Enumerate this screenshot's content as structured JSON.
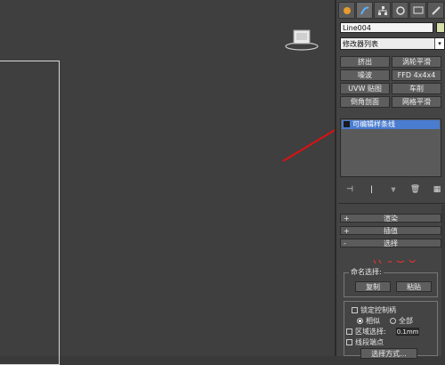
{
  "object_name": "Line004",
  "modifier_list": "修改器列表",
  "dropdown_arrow": "▾",
  "modifier_buttons": [
    "挤出",
    "涡轮平滑",
    "噪波",
    "FFD 4x4x4",
    "UVW 贴图",
    "车削",
    "倒角剖面",
    "网格平滑"
  ],
  "stack_item": "可编辑样条线",
  "rollouts": {
    "render": {
      "sign": "+",
      "label": "渲染"
    },
    "interp": {
      "sign": "+",
      "label": "插值"
    },
    "select": {
      "sign": "-",
      "label": "选择"
    }
  },
  "named_selections": {
    "title": "命名选择:",
    "copy": "复制",
    "paste": "粘贴"
  },
  "lock_handles": "锁定控制柄",
  "similar": "相似",
  "all": "全部",
  "area_select": "区域选择:",
  "area_value": "0.1mm",
  "segment_end": "线段端点",
  "select_by": "选择方式...",
  "colors": {
    "accent": "#4a7cd0",
    "arrow": "#e01010",
    "swatch": "#d7dfaa"
  }
}
